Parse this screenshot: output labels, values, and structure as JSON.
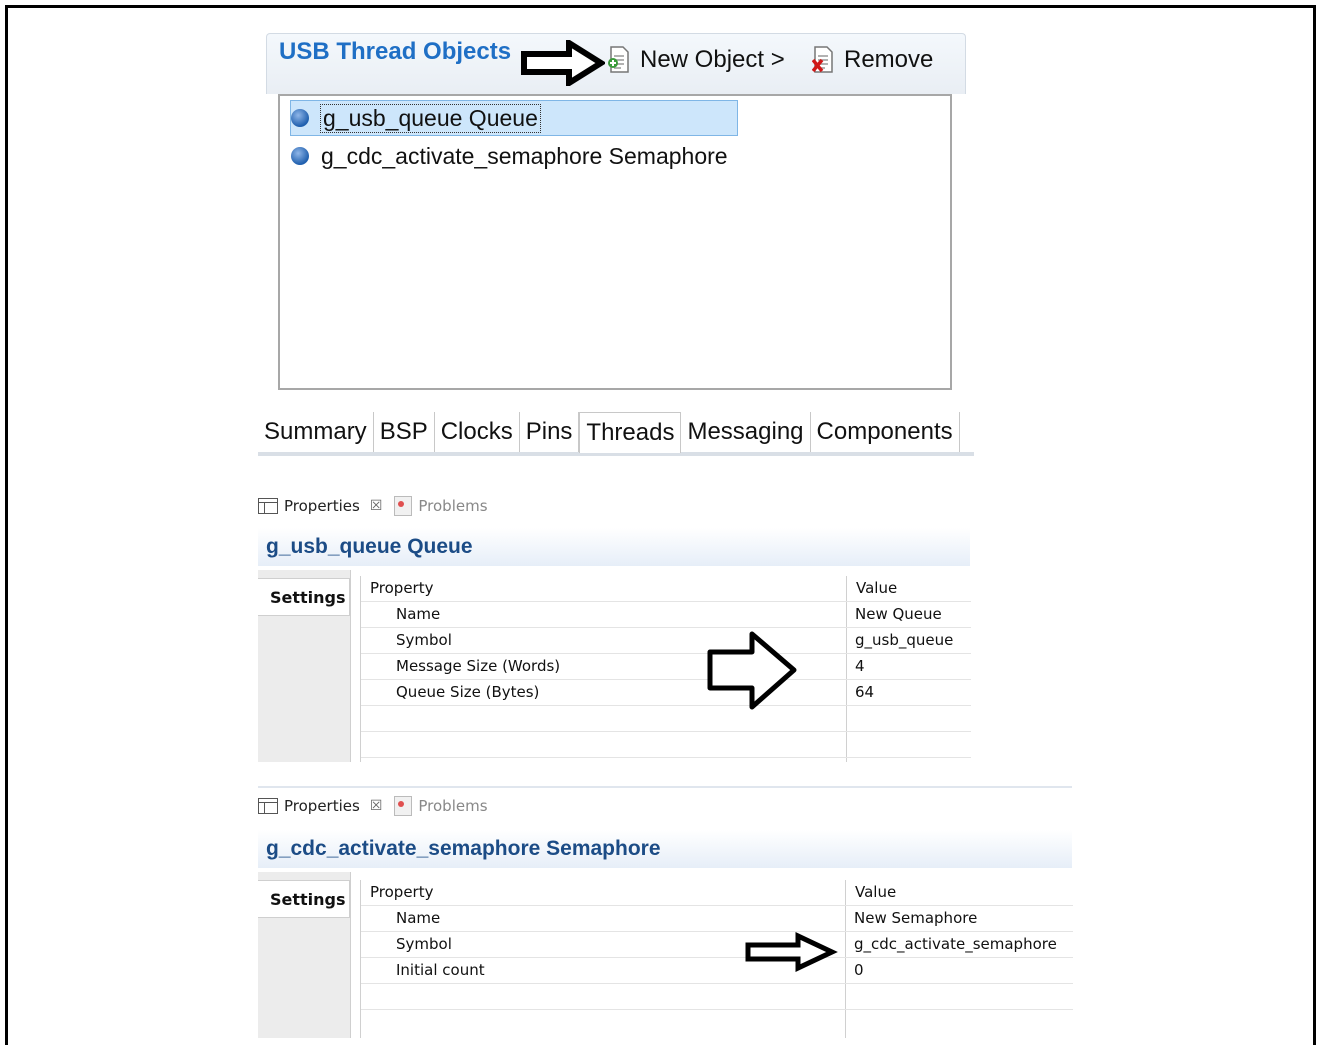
{
  "thread_objects": {
    "title": "USB Thread Objects",
    "new_object_label": "New Object >",
    "remove_label": "Remove",
    "items": [
      {
        "label": "g_usb_queue Queue"
      },
      {
        "label": "g_cdc_activate_semaphore Semaphore"
      }
    ]
  },
  "tabs": [
    {
      "label": "Summary"
    },
    {
      "label": "BSP"
    },
    {
      "label": "Clocks"
    },
    {
      "label": "Pins"
    },
    {
      "label": "Threads"
    },
    {
      "label": "Messaging"
    },
    {
      "label": "Components"
    }
  ],
  "views": [
    {
      "properties_tab": "Properties",
      "problems_tab": "Problems",
      "close_glyph": "☒",
      "title": "g_usb_queue Queue",
      "side_tab": "Settings",
      "col_property": "Property",
      "col_value": "Value",
      "rows": [
        {
          "property": "Name",
          "value": "New Queue"
        },
        {
          "property": "Symbol",
          "value": "g_usb_queue"
        },
        {
          "property": "Message Size (Words)",
          "value": "4"
        },
        {
          "property": "Queue Size (Bytes)",
          "value": "64"
        }
      ]
    },
    {
      "properties_tab": "Properties",
      "problems_tab": "Problems",
      "close_glyph": "☒",
      "title": "g_cdc_activate_semaphore Semaphore",
      "side_tab": "Settings",
      "col_property": "Property",
      "col_value": "Value",
      "rows": [
        {
          "property": "Name",
          "value": "New Semaphore"
        },
        {
          "property": "Symbol",
          "value": "g_cdc_activate_semaphore"
        },
        {
          "property": "Initial count",
          "value": "0"
        }
      ]
    }
  ]
}
